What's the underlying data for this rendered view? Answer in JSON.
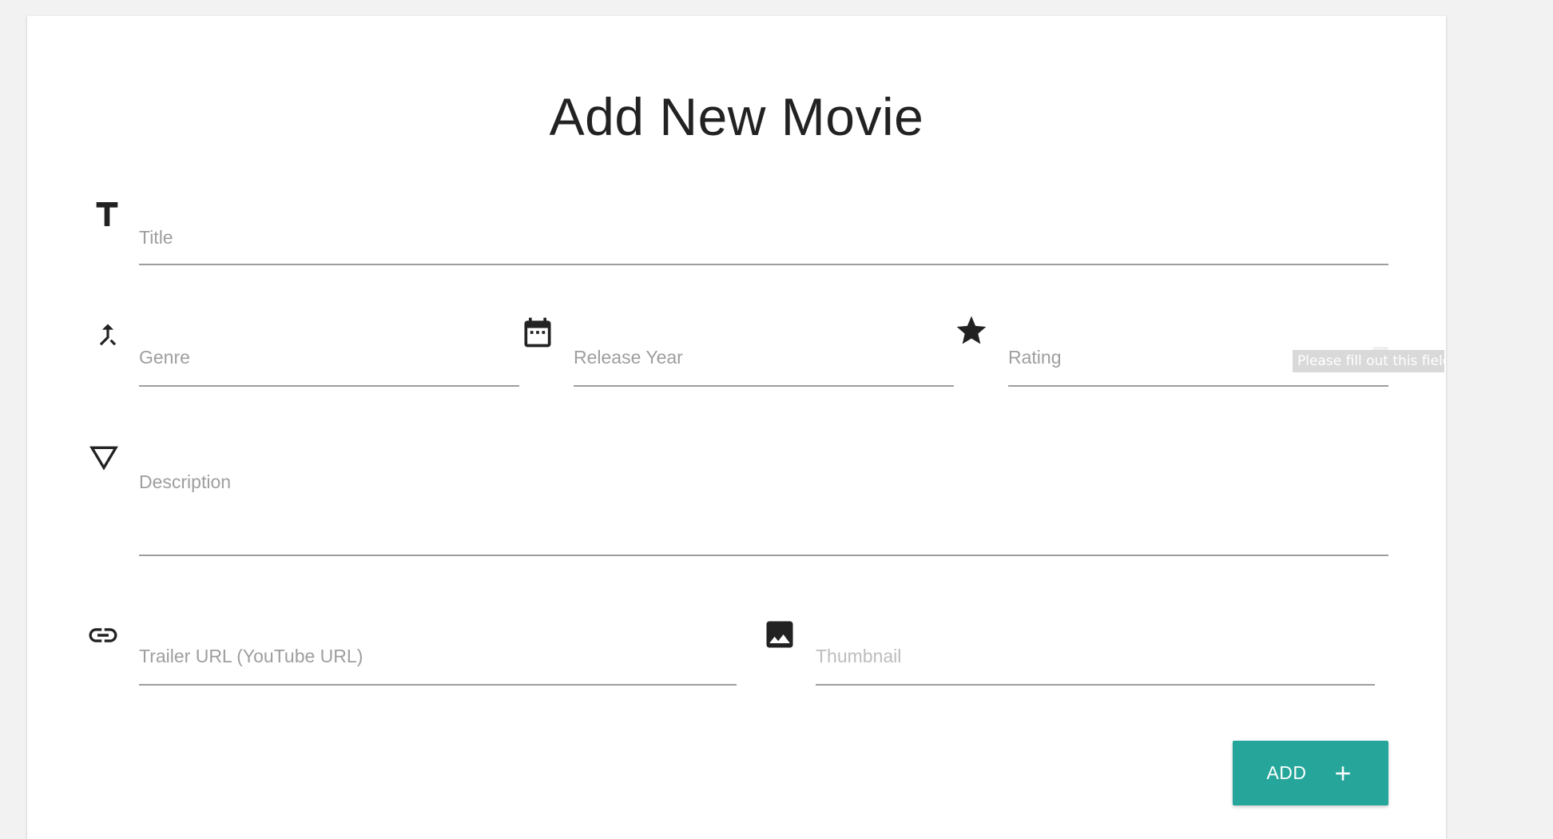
{
  "form": {
    "title": "Add New Movie",
    "fields": {
      "title": {
        "label": "Title",
        "icon": "text-title-icon"
      },
      "genre": {
        "label": "Genre",
        "icon": "merge-icon"
      },
      "release_year": {
        "label": "Release Year",
        "icon": "calendar-icon"
      },
      "rating": {
        "label": "Rating",
        "icon": "star-icon"
      },
      "description": {
        "label": "Description",
        "icon": "triangle-down-icon"
      },
      "trailer_url": {
        "label": "Trailer URL (YouTube URL)",
        "icon": "link-icon"
      },
      "thumbnail": {
        "label": "Thumbnail",
        "icon": "image-icon"
      }
    },
    "validation_tooltip": "Please fill out this field.",
    "add_button": {
      "label": "ADD",
      "icon": "plus-icon"
    }
  },
  "colors": {
    "accent": "#26a69a",
    "label": "#9e9e9e",
    "underline": "#9e9e9e",
    "title_text": "#222222",
    "background": "#f2f2f2"
  }
}
